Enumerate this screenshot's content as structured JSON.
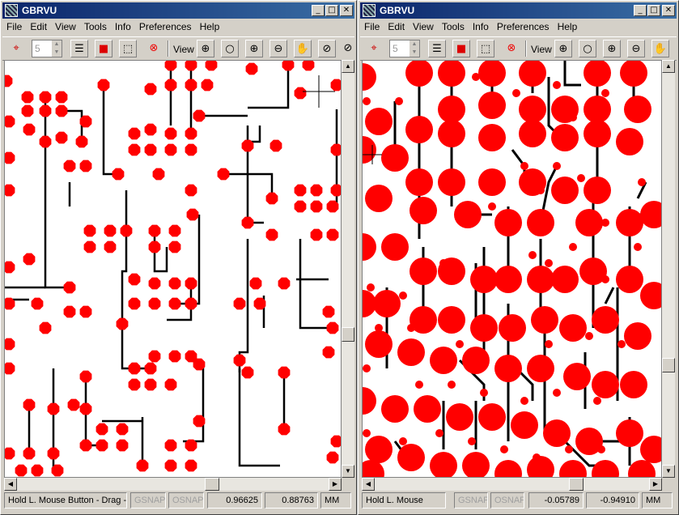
{
  "windows": [
    {
      "title": "GBRVU",
      "menu": [
        "File",
        "Edit",
        "View",
        "Tools",
        "Info",
        "Preferences",
        "Help"
      ],
      "toolbar": {
        "aperture_value": "5",
        "view_label": "View"
      },
      "status": {
        "hint": "Hold L. Mouse Button - Drag -",
        "gsnap": "GSNAP",
        "osnap": "OSNAP",
        "x": "0.96625",
        "y": "0.88763",
        "units": "MM"
      }
    },
    {
      "title": "GBRVU",
      "menu": [
        "File",
        "Edit",
        "View",
        "Tools",
        "Info",
        "Preferences",
        "Help"
      ],
      "toolbar": {
        "aperture_value": "5",
        "view_label": "View"
      },
      "status": {
        "hint": "Hold L. Mouse",
        "gsnap": "GSNAP",
        "osnap": "OSNAP",
        "x": "-0.05789",
        "y": "-0.94910",
        "units": "MM"
      }
    }
  ],
  "colors": {
    "pad": "#ff0000",
    "trace": "#000000",
    "canvas": "#ffffff",
    "titlebar": "#0a246a"
  }
}
